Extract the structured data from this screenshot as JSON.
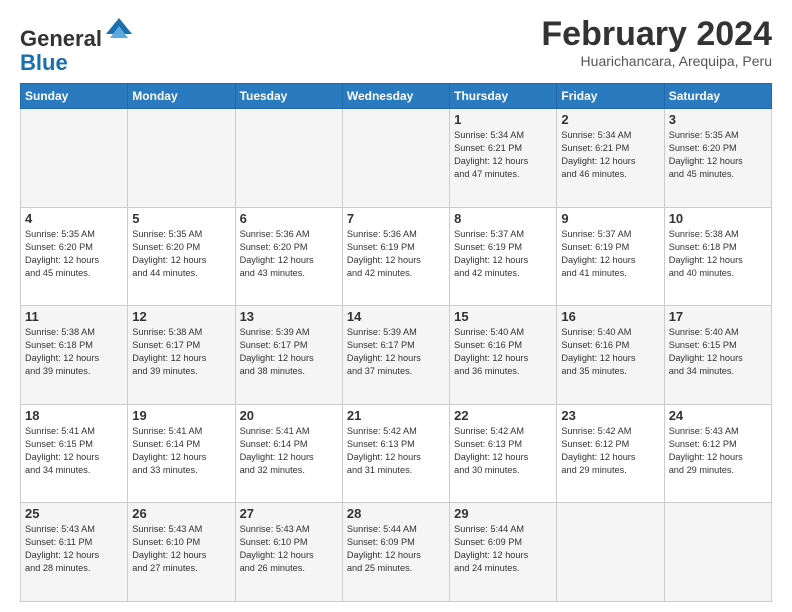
{
  "header": {
    "logo_line1": "General",
    "logo_line2": "Blue",
    "month_title": "February 2024",
    "location": "Huarichancara, Arequipa, Peru"
  },
  "days_of_week": [
    "Sunday",
    "Monday",
    "Tuesday",
    "Wednesday",
    "Thursday",
    "Friday",
    "Saturday"
  ],
  "weeks": [
    [
      {
        "day": "",
        "text": ""
      },
      {
        "day": "",
        "text": ""
      },
      {
        "day": "",
        "text": ""
      },
      {
        "day": "",
        "text": ""
      },
      {
        "day": "1",
        "text": "Sunrise: 5:34 AM\nSunset: 6:21 PM\nDaylight: 12 hours\nand 47 minutes."
      },
      {
        "day": "2",
        "text": "Sunrise: 5:34 AM\nSunset: 6:21 PM\nDaylight: 12 hours\nand 46 minutes."
      },
      {
        "day": "3",
        "text": "Sunrise: 5:35 AM\nSunset: 6:20 PM\nDaylight: 12 hours\nand 45 minutes."
      }
    ],
    [
      {
        "day": "4",
        "text": "Sunrise: 5:35 AM\nSunset: 6:20 PM\nDaylight: 12 hours\nand 45 minutes."
      },
      {
        "day": "5",
        "text": "Sunrise: 5:35 AM\nSunset: 6:20 PM\nDaylight: 12 hours\nand 44 minutes."
      },
      {
        "day": "6",
        "text": "Sunrise: 5:36 AM\nSunset: 6:20 PM\nDaylight: 12 hours\nand 43 minutes."
      },
      {
        "day": "7",
        "text": "Sunrise: 5:36 AM\nSunset: 6:19 PM\nDaylight: 12 hours\nand 42 minutes."
      },
      {
        "day": "8",
        "text": "Sunrise: 5:37 AM\nSunset: 6:19 PM\nDaylight: 12 hours\nand 42 minutes."
      },
      {
        "day": "9",
        "text": "Sunrise: 5:37 AM\nSunset: 6:19 PM\nDaylight: 12 hours\nand 41 minutes."
      },
      {
        "day": "10",
        "text": "Sunrise: 5:38 AM\nSunset: 6:18 PM\nDaylight: 12 hours\nand 40 minutes."
      }
    ],
    [
      {
        "day": "11",
        "text": "Sunrise: 5:38 AM\nSunset: 6:18 PM\nDaylight: 12 hours\nand 39 minutes."
      },
      {
        "day": "12",
        "text": "Sunrise: 5:38 AM\nSunset: 6:17 PM\nDaylight: 12 hours\nand 39 minutes."
      },
      {
        "day": "13",
        "text": "Sunrise: 5:39 AM\nSunset: 6:17 PM\nDaylight: 12 hours\nand 38 minutes."
      },
      {
        "day": "14",
        "text": "Sunrise: 5:39 AM\nSunset: 6:17 PM\nDaylight: 12 hours\nand 37 minutes."
      },
      {
        "day": "15",
        "text": "Sunrise: 5:40 AM\nSunset: 6:16 PM\nDaylight: 12 hours\nand 36 minutes."
      },
      {
        "day": "16",
        "text": "Sunrise: 5:40 AM\nSunset: 6:16 PM\nDaylight: 12 hours\nand 35 minutes."
      },
      {
        "day": "17",
        "text": "Sunrise: 5:40 AM\nSunset: 6:15 PM\nDaylight: 12 hours\nand 34 minutes."
      }
    ],
    [
      {
        "day": "18",
        "text": "Sunrise: 5:41 AM\nSunset: 6:15 PM\nDaylight: 12 hours\nand 34 minutes."
      },
      {
        "day": "19",
        "text": "Sunrise: 5:41 AM\nSunset: 6:14 PM\nDaylight: 12 hours\nand 33 minutes."
      },
      {
        "day": "20",
        "text": "Sunrise: 5:41 AM\nSunset: 6:14 PM\nDaylight: 12 hours\nand 32 minutes."
      },
      {
        "day": "21",
        "text": "Sunrise: 5:42 AM\nSunset: 6:13 PM\nDaylight: 12 hours\nand 31 minutes."
      },
      {
        "day": "22",
        "text": "Sunrise: 5:42 AM\nSunset: 6:13 PM\nDaylight: 12 hours\nand 30 minutes."
      },
      {
        "day": "23",
        "text": "Sunrise: 5:42 AM\nSunset: 6:12 PM\nDaylight: 12 hours\nand 29 minutes."
      },
      {
        "day": "24",
        "text": "Sunrise: 5:43 AM\nSunset: 6:12 PM\nDaylight: 12 hours\nand 29 minutes."
      }
    ],
    [
      {
        "day": "25",
        "text": "Sunrise: 5:43 AM\nSunset: 6:11 PM\nDaylight: 12 hours\nand 28 minutes."
      },
      {
        "day": "26",
        "text": "Sunrise: 5:43 AM\nSunset: 6:10 PM\nDaylight: 12 hours\nand 27 minutes."
      },
      {
        "day": "27",
        "text": "Sunrise: 5:43 AM\nSunset: 6:10 PM\nDaylight: 12 hours\nand 26 minutes."
      },
      {
        "day": "28",
        "text": "Sunrise: 5:44 AM\nSunset: 6:09 PM\nDaylight: 12 hours\nand 25 minutes."
      },
      {
        "day": "29",
        "text": "Sunrise: 5:44 AM\nSunset: 6:09 PM\nDaylight: 12 hours\nand 24 minutes."
      },
      {
        "day": "",
        "text": ""
      },
      {
        "day": "",
        "text": ""
      }
    ]
  ]
}
